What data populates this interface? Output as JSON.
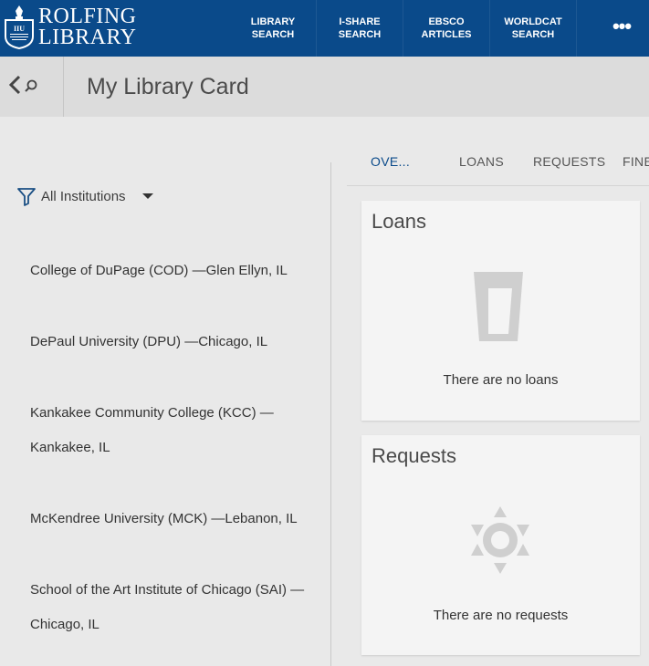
{
  "header": {
    "logo_line1": "ROLFING",
    "logo_line2": "LIBRARY",
    "nav": [
      "LIBRARY\nSEARCH",
      "I-SHARE\nSEARCH",
      "EBSCO\nARTICLES",
      "WORLDCAT\nSEARCH"
    ],
    "more_label": "•••"
  },
  "subheader": {
    "title": "My Library Card"
  },
  "filter": {
    "label": "All Institutions"
  },
  "institutions": [
    "College of DuPage (COD) —Glen Ellyn, IL",
    "DePaul University (DPU) —Chicago, IL",
    "Kankakee Community College (KCC) — Kankakee, IL",
    "McKendree University (MCK) —Lebanon, IL",
    "School of the Art Institute of Chicago (SAI) —Chicago, IL"
  ],
  "tabs": [
    "OVE...",
    "LOANS",
    "REQUESTS",
    "FINE"
  ],
  "loans_card": {
    "title": "Loans",
    "empty": "There are no loans"
  },
  "requests_card": {
    "title": "Requests",
    "empty": "There are no requests"
  },
  "colors": {
    "header_bg": "#0a4a8a",
    "accent": "#0a4a8a",
    "placeholder_icon": "#cfcfcf"
  }
}
